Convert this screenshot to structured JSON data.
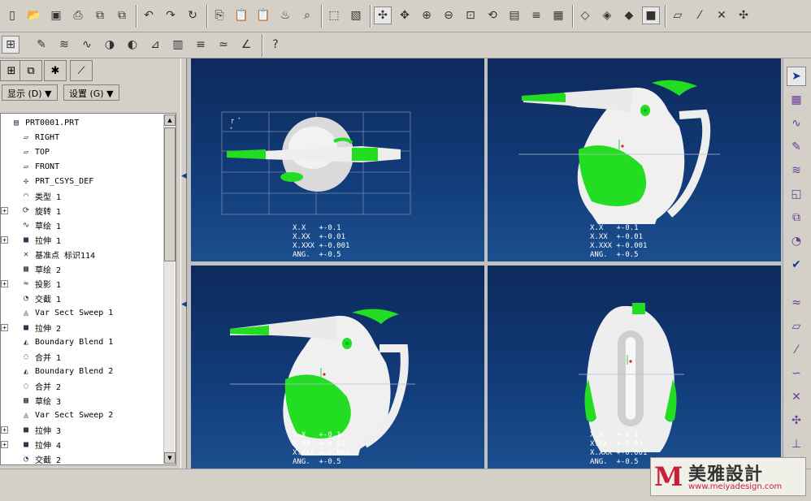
{
  "toolbar": {
    "row1_icons": [
      "new-icon",
      "open-icon",
      "save-icon",
      "print-icon",
      "save-copy-icon",
      "backup-icon",
      "undo-icon",
      "redo-icon",
      "regenerate-icon",
      "copy-icon",
      "paste-icon",
      "paste-special-icon",
      "model-player-icon",
      "find-icon",
      "select-box-icon",
      "repaint-icon",
      "spin-center-icon",
      "orient-mode-icon",
      "zoom-in-icon",
      "zoom-out-icon",
      "refit-icon",
      "reorient-icon",
      "saved-views-icon",
      "layers-icon",
      "view-manager-icon",
      "wireframe-icon",
      "hidden-line-icon",
      "no-hidden-icon",
      "shading-icon",
      "datum-planes-icon",
      "datum-axes-icon",
      "datum-points-icon",
      "coord-sys-icon"
    ],
    "row2_icons": [
      "sketch-icon",
      "style-icon",
      "reflection-icon",
      "curvature-icon",
      "draft-icon",
      "slope-icon",
      "section-icon",
      "offset-icon",
      "deviation-icon",
      "dihedral-icon",
      "context-help-icon"
    ]
  },
  "left_panel": {
    "menu_display": "显示 (D) ▼",
    "menu_settings": "设置 (G) ▼",
    "tree_items": [
      {
        "label": "PRT0001.PRT",
        "icon": "part-icon",
        "expand": ""
      },
      {
        "label": "RIGHT",
        "icon": "datum-plane-icon",
        "expand": ""
      },
      {
        "label": "TOP",
        "icon": "datum-plane-icon",
        "expand": ""
      },
      {
        "label": "FRONT",
        "icon": "datum-plane-icon",
        "expand": ""
      },
      {
        "label": "PRT_CSYS_DEF",
        "icon": "csys-icon",
        "expand": ""
      },
      {
        "label": "类型 1",
        "icon": "type-icon",
        "expand": ""
      },
      {
        "label": "旋转 1",
        "icon": "revolve-icon",
        "expand": "+"
      },
      {
        "label": "草绘 1",
        "icon": "sketch-icon",
        "expand": ""
      },
      {
        "label": "拉伸 1",
        "icon": "extrude-icon",
        "expand": "+"
      },
      {
        "label": "基准点 标识114",
        "icon": "datum-point-icon",
        "expand": ""
      },
      {
        "label": "草绘 2",
        "icon": "sketch-hatch-icon",
        "expand": ""
      },
      {
        "label": "投影 1",
        "icon": "project-icon",
        "expand": "+"
      },
      {
        "label": "交截 1",
        "icon": "intersect-icon",
        "expand": ""
      },
      {
        "label": "Var Sect Sweep 1",
        "icon": "sweep-icon",
        "expand": ""
      },
      {
        "label": "拉伸 2",
        "icon": "extrude-icon",
        "expand": "+"
      },
      {
        "label": "Boundary Blend 1",
        "icon": "blend-icon",
        "expand": ""
      },
      {
        "label": "合并 1",
        "icon": "merge-icon",
        "expand": ""
      },
      {
        "label": "Boundary Blend 2",
        "icon": "blend-icon",
        "expand": ""
      },
      {
        "label": "合并 2",
        "icon": "merge-icon",
        "expand": ""
      },
      {
        "label": "草绘 3",
        "icon": "sketch-hatch-icon",
        "expand": ""
      },
      {
        "label": "Var Sect Sweep 2",
        "icon": "sweep-icon",
        "expand": ""
      },
      {
        "label": "拉伸 3",
        "icon": "extrude-icon",
        "expand": "+"
      },
      {
        "label": "拉伸 4",
        "icon": "extrude-icon",
        "expand": "+"
      },
      {
        "label": "交截 2",
        "icon": "intersect-icon",
        "expand": ""
      }
    ]
  },
  "viewports": {
    "tolerance": "X.X   +-0.1\nX.XX  +-0.01\nX.XXX +-0.001\nANG.  +-0.5"
  },
  "right_toolbar_icons": [
    "select-arrow-icon",
    "plane-icon",
    "curve-icon",
    "sketch-curve-icon",
    "surface-icon",
    "boundary-icon",
    "offset-icon",
    "analysis-icon",
    "check-icon",
    "graph-icon",
    "datum-plane-icon",
    "axis-icon",
    "curve2-icon",
    "point-icon",
    "csys-icon",
    "analysis2-icon",
    "ruler-icon"
  ],
  "watermark": {
    "logo": "M",
    "title": "美雅設計",
    "url": "www.meiyadesign.com"
  },
  "colors": {
    "viewport_top": "#0d2a5c",
    "viewport_bottom": "#1b4f8f",
    "accent_green": "#22dd22",
    "watermark_red": "#c8203a"
  }
}
